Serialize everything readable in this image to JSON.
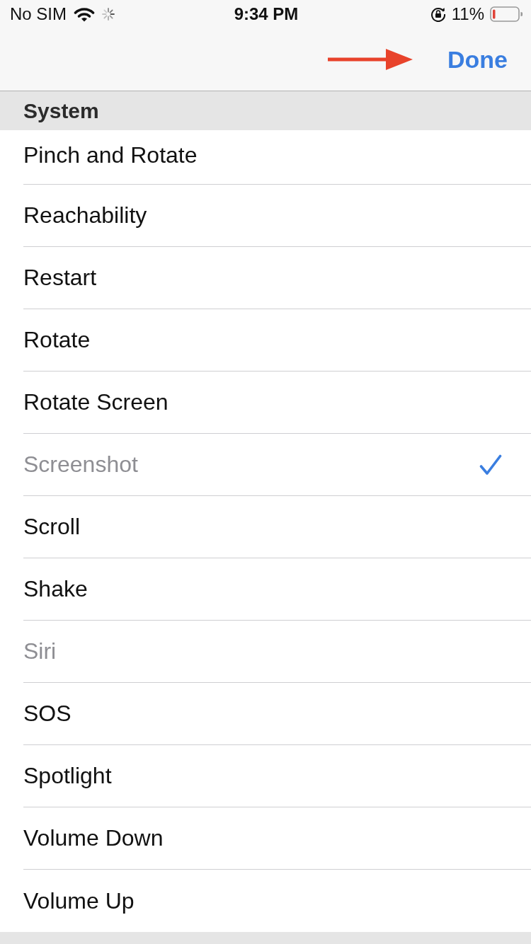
{
  "status_bar": {
    "carrier": "No SIM",
    "time": "9:34 PM",
    "battery_percent": "11%"
  },
  "nav_bar": {
    "done_button": "Done"
  },
  "section": {
    "title": "System",
    "items": [
      {
        "label": "Pinch and Rotate",
        "disabled": false,
        "checked": false
      },
      {
        "label": "Reachability",
        "disabled": false,
        "checked": false
      },
      {
        "label": "Restart",
        "disabled": false,
        "checked": false
      },
      {
        "label": "Rotate",
        "disabled": false,
        "checked": false
      },
      {
        "label": "Rotate Screen",
        "disabled": false,
        "checked": false
      },
      {
        "label": "Screenshot",
        "disabled": true,
        "checked": true
      },
      {
        "label": "Scroll",
        "disabled": false,
        "checked": false
      },
      {
        "label": "Shake",
        "disabled": false,
        "checked": false
      },
      {
        "label": "Siri",
        "disabled": true,
        "checked": false
      },
      {
        "label": "SOS",
        "disabled": false,
        "checked": false
      },
      {
        "label": "Spotlight",
        "disabled": false,
        "checked": false
      },
      {
        "label": "Volume Down",
        "disabled": false,
        "checked": false
      },
      {
        "label": "Volume Up",
        "disabled": false,
        "checked": false
      }
    ]
  }
}
